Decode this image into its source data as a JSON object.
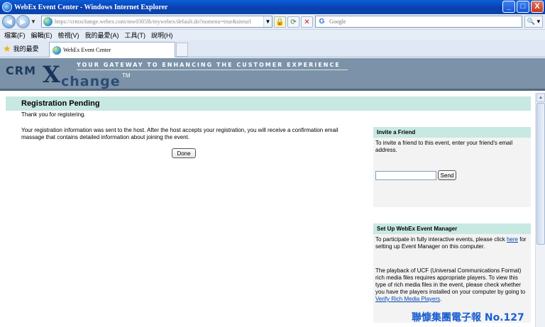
{
  "window": {
    "title": "WebEx Event Center - Windows Internet Explorer",
    "minimize": "_",
    "maximize": "□",
    "close": "X"
  },
  "nav": {
    "back": "◀",
    "forward": "▶",
    "dropdown": "▼",
    "url": "https://crmxchange.webex.com/mw0305lb/mywebex/default.do?nomenu=true&siteurl",
    "lock": "🔒",
    "refresh": "⟳",
    "stop": "✕",
    "search_placeholder": "Google",
    "search_go": "🔍 ▾"
  },
  "menu": [
    "檔案(F)",
    "編輯(E)",
    "檢視(V)",
    "我的最愛(A)",
    "工具(T)",
    "說明(H)"
  ],
  "favorites_label": "我的最愛",
  "tab": {
    "title": "WebEx Event Center"
  },
  "banner": {
    "logo_crm": "CRM",
    "logo_x": "X",
    "logo_change": "change",
    "logo_tm": "TM",
    "tagline": "YOUR GATEWAY TO ENHANCING THE CUSTOMER EXPERIENCE"
  },
  "registration": {
    "heading": "Registration Pending",
    "thanks": "Thank you for registering.",
    "info": "Your registration information was sent to the host. After the host accepts your registration, you will receive a confirmation email massage that contains detailed information about joining the event.",
    "done_label": "Done"
  },
  "invite": {
    "heading": "Invite a Friend",
    "text": "To invite a friend to this event, enter your friend's email address.",
    "input_value": "",
    "send_label": "Send"
  },
  "event_manager": {
    "heading": "Set Up WebEx Event Manager",
    "text_before": "To participate in fully interactive events, please click ",
    "link_here": "here",
    "text_after": " for setting up Event Manager on this computer.",
    "text2_before": "The playback of UCF (Universal Communications Format) rich media files requires appropriate players. To view this type of rich media files in the event, please check whether you have the players installed on your computer by going to ",
    "link_verify": "Verify Rich Media Players",
    "text2_after": "."
  },
  "watermark": "聯慷集團電子報 No.127",
  "scrollbar_up": "▲"
}
